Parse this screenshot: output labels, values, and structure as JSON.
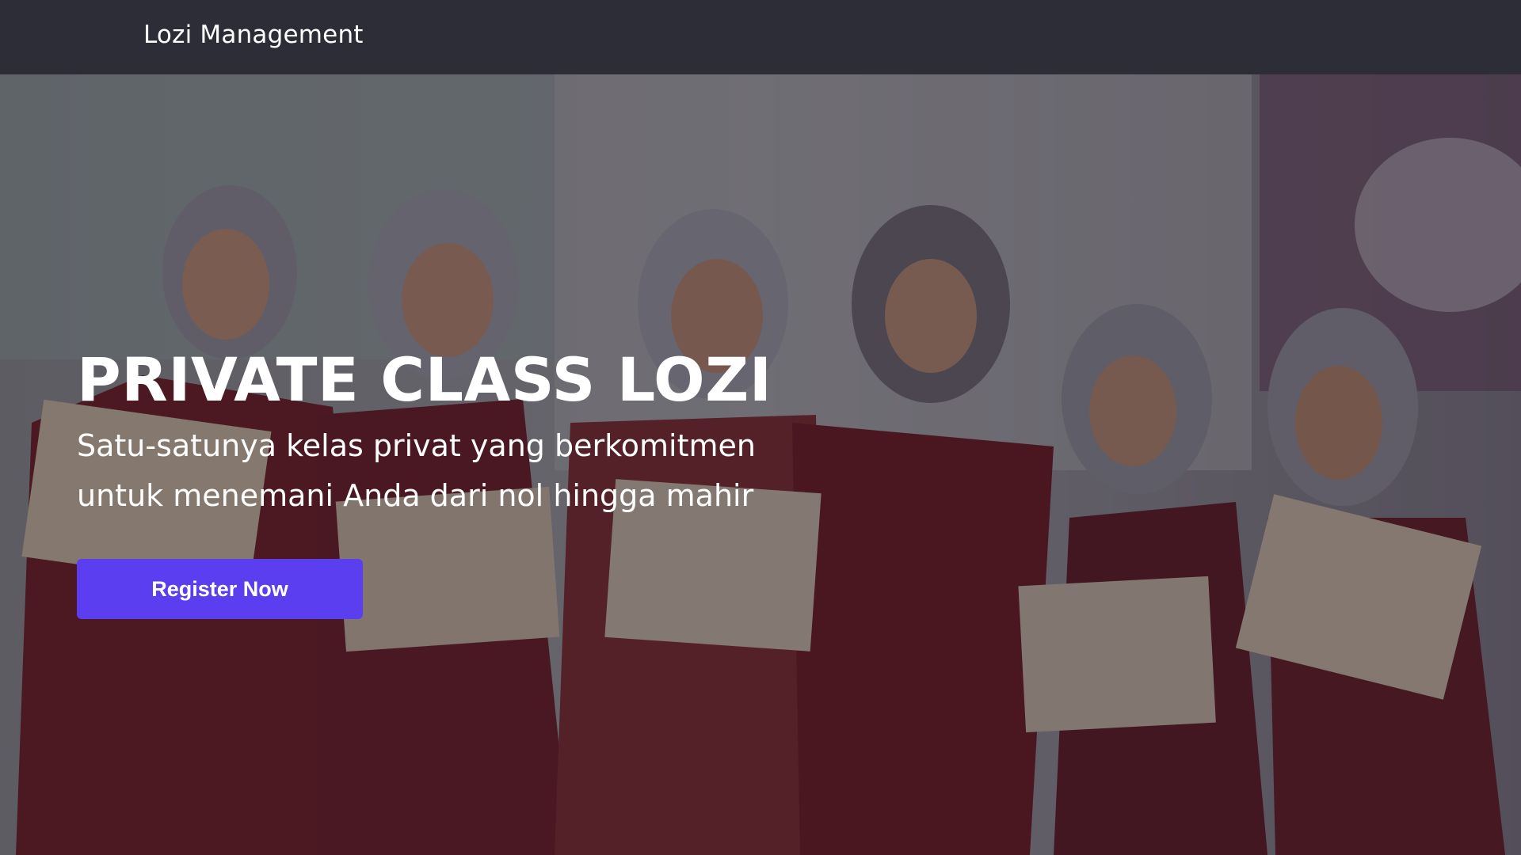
{
  "navbar": {
    "brand": "Lozi Management"
  },
  "hero": {
    "title": "PRIVATE CLASS LOZI",
    "subtitle": "Satu-satunya kelas privat yang berkomitmen untuk menemani Anda dari nol hingga mahir",
    "cta_label": "Register Now",
    "background_image": "photo-of-women-in-hijabs-holding-certificates"
  },
  "colors": {
    "navbar_bg": "#2d2d38",
    "accent": "#5b3ef0",
    "text": "#ffffff"
  }
}
